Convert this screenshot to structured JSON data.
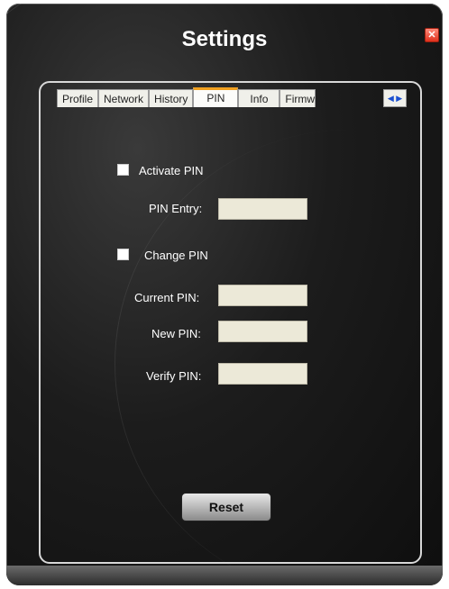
{
  "window": {
    "title": "Settings",
    "close_label": "✕"
  },
  "tabs": [
    {
      "label": "Profile"
    },
    {
      "label": "Network"
    },
    {
      "label": "History"
    },
    {
      "label": "PIN",
      "active": true
    },
    {
      "label": "Info"
    },
    {
      "label": "Firmw"
    }
  ],
  "tab_scroll": {
    "left": "◀",
    "right": "▶"
  },
  "form": {
    "activate_pin_label": "Activate PIN",
    "activate_pin_checked": false,
    "pin_entry_label": "PIN Entry:",
    "pin_entry_value": "",
    "change_pin_label": "Change PIN",
    "change_pin_checked": false,
    "current_pin_label": "Current PIN:",
    "current_pin_value": "",
    "new_pin_label": "New PIN:",
    "new_pin_value": "",
    "verify_pin_label": "Verify PIN:",
    "verify_pin_value": ""
  },
  "reset_label": "Reset",
  "colors": {
    "tab_accent": "#f0a020",
    "field_bg": "#ece9d8",
    "window_bg": "#1c1c1c"
  }
}
